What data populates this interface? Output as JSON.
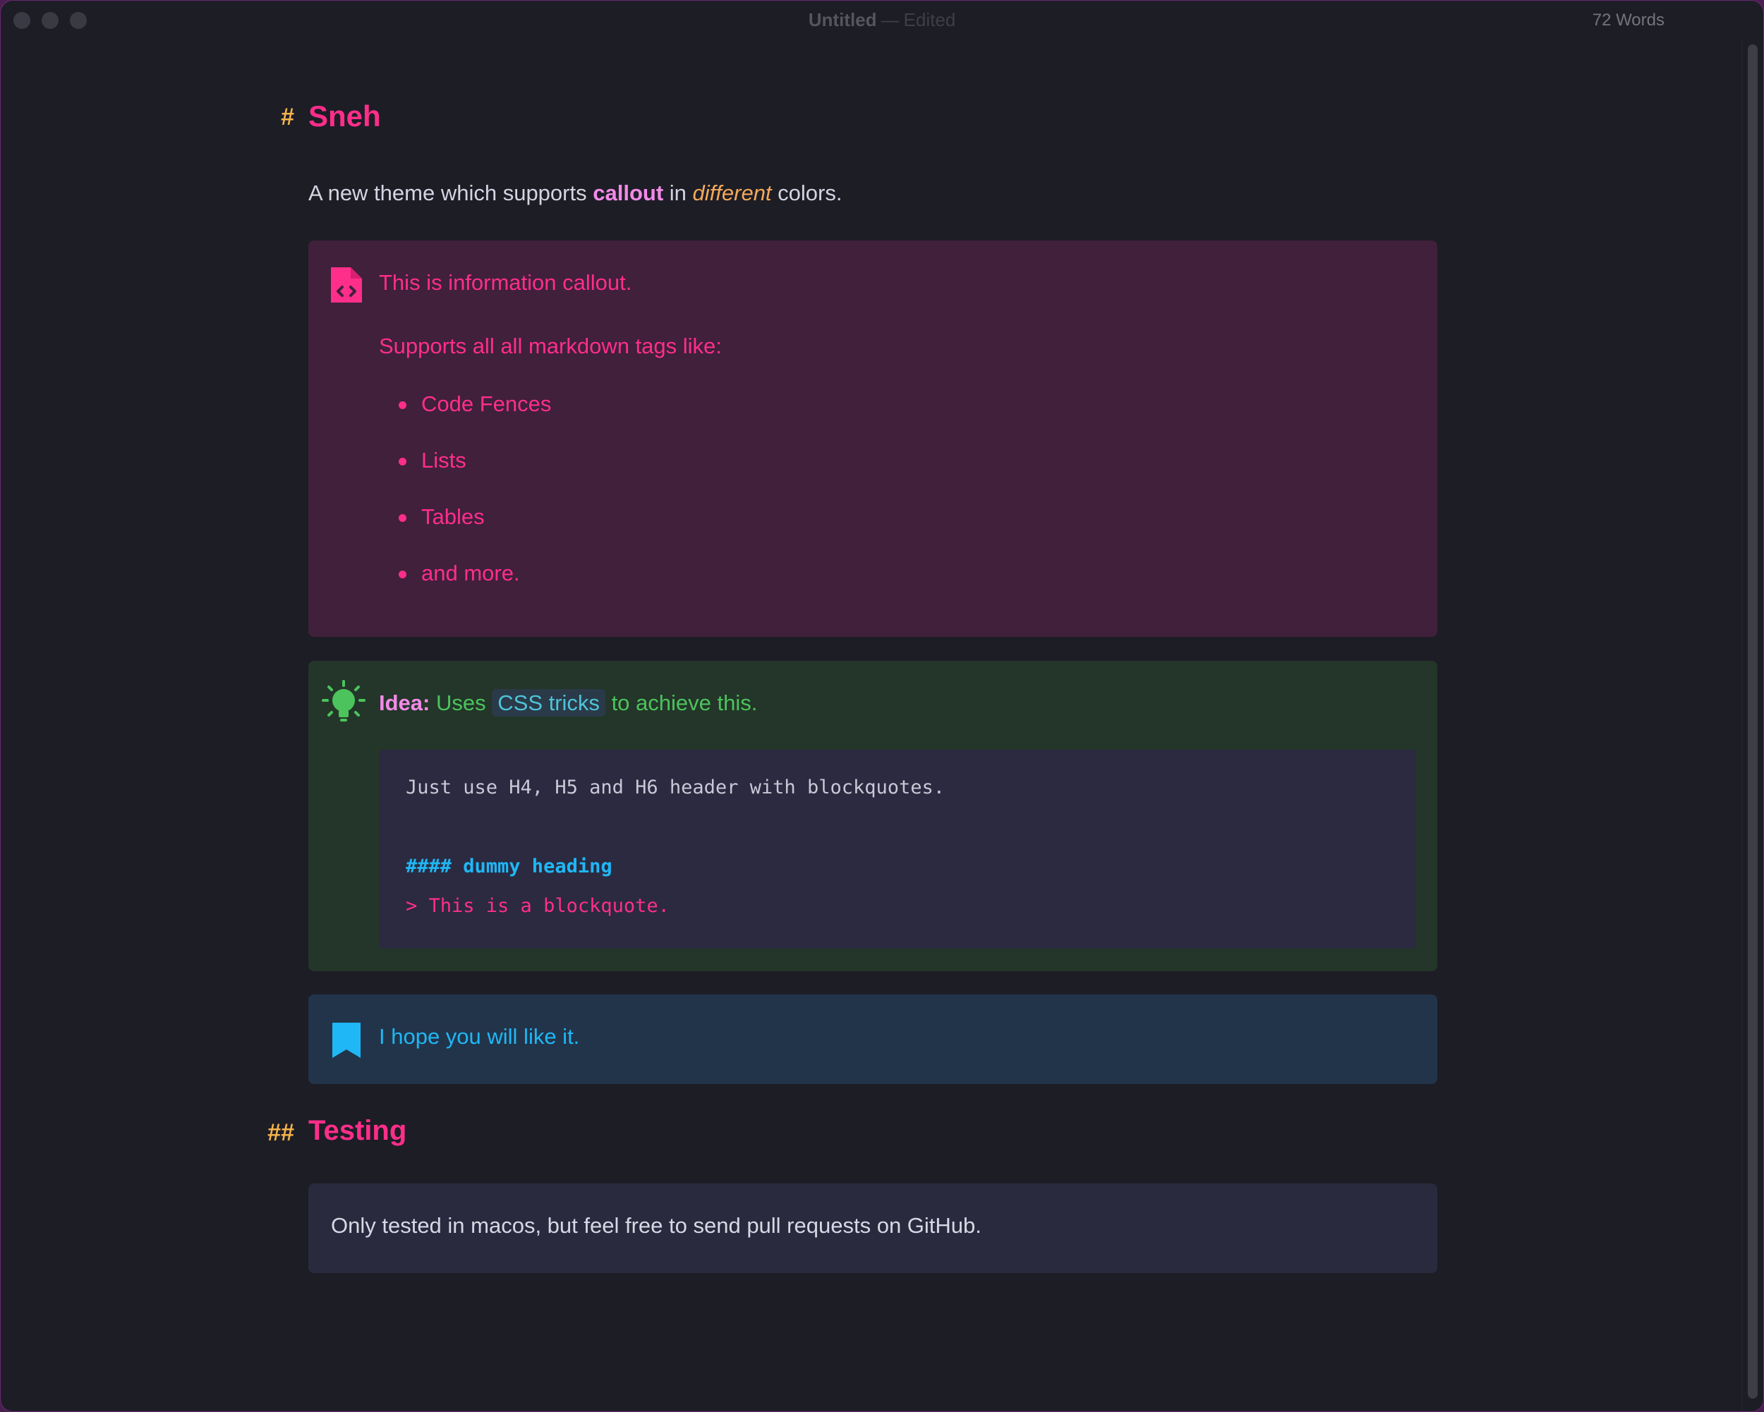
{
  "window": {
    "title": "Untitled",
    "separator": "—",
    "status": "Edited",
    "word_count": "72 Words"
  },
  "doc": {
    "h1_marker": "#",
    "h1": "Sneh",
    "intro_pre": "A new theme which supports",
    "intro_strong": "callout",
    "intro_mid": "in",
    "intro_em": "different",
    "intro_post": "colors.",
    "info": {
      "icon": "file-code-icon",
      "line1": "This is information callout.",
      "line2": "Supports all all markdown tags like:",
      "items": [
        "Code Fences",
        "Lists",
        "Tables",
        "and more."
      ]
    },
    "idea": {
      "icon": "lightbulb-icon",
      "label": "Idea:",
      "text_pre": "Uses",
      "code": "CSS tricks",
      "text_post": "to achieve this.",
      "code_lines": [
        "Just use H4, H5 and H6 header with blockquotes.",
        "#### dummy heading",
        "> This is a blockquote."
      ]
    },
    "note": {
      "icon": "bookmark-icon",
      "text": "I hope you will like it."
    },
    "h2_marker": "##",
    "h2": "Testing",
    "plain": "Only tested in macos, but feel free to send pull requests on GitHub."
  },
  "colors": {
    "background": "#1d1d26",
    "heading": "#ff2e8a",
    "marker": "#f5b34a",
    "info_bg": "#40203b",
    "idea_bg": "#233629",
    "idea_text": "#4cc35c",
    "note_bg": "#22344a",
    "note_text": "#1fb7f5",
    "plain_bg": "#2a2a3f"
  }
}
